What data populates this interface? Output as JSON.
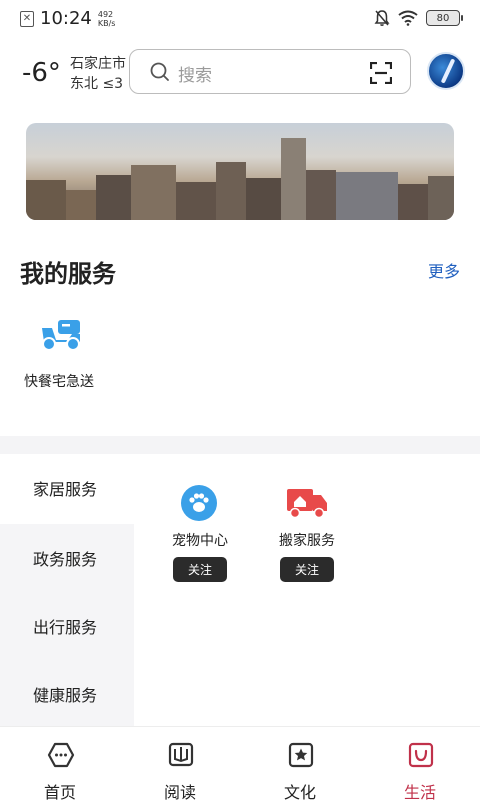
{
  "status": {
    "time": "10:24",
    "speed_value": "492",
    "speed_unit": "KB/s",
    "battery": "80"
  },
  "header": {
    "temperature": "-6°",
    "city": "石家庄市",
    "wind": "东北 ≤3",
    "search_placeholder": "搜索"
  },
  "my_services": {
    "title": "我的服务",
    "more": "更多",
    "items": [
      {
        "label": "快餐宅急送",
        "icon": "delivery-scooter-icon"
      }
    ]
  },
  "categories": {
    "nav": [
      {
        "label": "家居服务"
      },
      {
        "label": "政务服务"
      },
      {
        "label": "出行服务"
      },
      {
        "label": "健康服务"
      }
    ],
    "cards": [
      {
        "label": "宠物中心",
        "button": "关注",
        "icon": "paw-icon"
      },
      {
        "label": "搬家服务",
        "button": "关注",
        "icon": "moving-truck-icon"
      }
    ]
  },
  "tabs": [
    {
      "label": "首页",
      "icon": "home-icon"
    },
    {
      "label": "阅读",
      "icon": "book-icon"
    },
    {
      "label": "文化",
      "icon": "star-icon"
    },
    {
      "label": "生活",
      "icon": "life-icon",
      "active": true
    }
  ],
  "colors": {
    "accent_blue": "#1f5fbf",
    "active_tab": "#c0314a",
    "service_icon_blue": "#3aa0e8",
    "moving_red": "#e84a4a"
  }
}
